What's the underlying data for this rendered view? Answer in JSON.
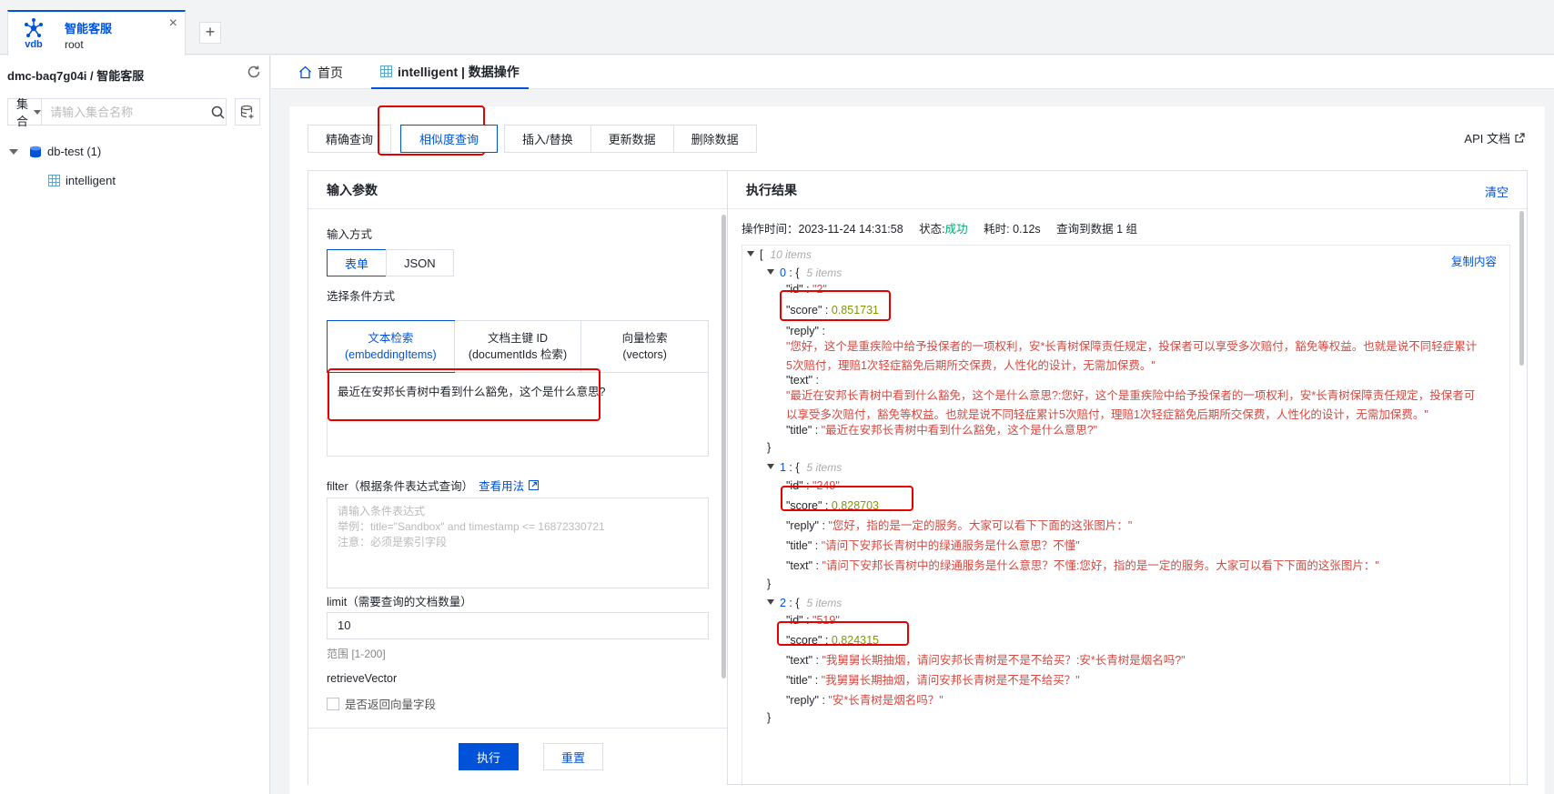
{
  "connection": {
    "logo_text": "vdb",
    "name": "智能客服",
    "user": "root",
    "close": "×",
    "add": "+"
  },
  "sidebar": {
    "header": "dmc-baq7g04i / 智能客服",
    "search_scope": "集合",
    "search_placeholder": "请输入集合名称",
    "db_label": "db-test (1)",
    "collection_label": "intelligent"
  },
  "page_tabs": {
    "home": "首页",
    "active": "intelligent | 数据操作"
  },
  "operation_tabs": [
    "精确查询",
    "相似度查询",
    "插入/替换",
    "更新数据",
    "删除数据"
  ],
  "api_doc": "API 文档",
  "input_panel": {
    "title": "输入参数",
    "input_mode_label": "输入方式",
    "modes": [
      "表单",
      "JSON"
    ],
    "condition_label": "选择条件方式",
    "condition_tabs": [
      {
        "line1": "文本检索",
        "line2": "(embeddingItems)"
      },
      {
        "line1": "文档主键 ID",
        "line2": "(documentIds 检索)"
      },
      {
        "line1": "向量检索",
        "line2": "(vectors)"
      }
    ],
    "query_text": "最近在安邦长青树中看到什么豁免，这个是什么意思?",
    "filter_label": "filter（根据条件表达式查询）",
    "filter_link": "查看用法",
    "filter_placeholder": [
      "请输入条件表达式",
      "举例：title=\"Sandbox\" and timestamp <= 16872330721",
      "注意：必须是索引字段"
    ],
    "limit_label": "limit（需要查询的文档数量）",
    "limit_value": "10",
    "limit_hint": "范围 [1-200]",
    "retrieve_label": "retrieveVector",
    "retrieve_checkbox": "是否返回向量字段",
    "run": "执行",
    "reset": "重置"
  },
  "result_panel": {
    "title": "执行结果",
    "clear": "清空",
    "meta": {
      "time_label": "操作时间：",
      "time": "2023-11-24 14:31:58",
      "status_label": "状态:",
      "status": "成功",
      "cost": "耗时: 0.12s",
      "found": "查询到数据 1 组"
    },
    "copy": "复制内容",
    "root_count": "10 items",
    "items": [
      {
        "index": "0",
        "count": "5 items",
        "id": "\"2\"",
        "score": "0.851731",
        "reply": "\"您好，这个是重疾险中给予投保者的一项权利，安*长青树保障责任规定，投保者可以享受多次赔付，豁免等权益。也就是说不同轻症累计5次赔付，理赔1次轻症豁免后期所交保费，人性化的设计，无需加保费。\"",
        "text": "\"最近在安邦长青树中看到什么豁免，这个是什么意思?:您好，这个是重疾险中给予投保者的一项权利，安*长青树保障责任规定，投保者可以享受多次赔付，豁免等权益。也就是说不同轻症累计5次赔付，理赔1次轻症豁免后期所交保费，人性化的设计，无需加保费。\"",
        "title": "\"最近在安邦长青树中看到什么豁免，这个是什么意思?\""
      },
      {
        "index": "1",
        "count": "5 items",
        "id": "\"249\"",
        "score": "0.828703",
        "reply": "\"您好，指的是一定的服务。大家可以看下下面的这张图片：\"",
        "title": "\"请问下安邦长青树中的绿通服务是什么意思？不懂\"",
        "text": "\"请问下安邦长青树中的绿通服务是什么意思？不懂:您好，指的是一定的服务。大家可以看下下面的这张图片：\""
      },
      {
        "index": "2",
        "count": "5 items",
        "id": "\"519\"",
        "score": "0.824315",
        "text": "\"我舅舅长期抽烟，请问安邦长青树是不是不给买？:安*长青树是烟名吗?\"",
        "title": "\"我舅舅长期抽烟，请问安邦长青树是不是不给买？\"",
        "reply": "\"安*长青树是烟名吗？\""
      }
    ]
  }
}
